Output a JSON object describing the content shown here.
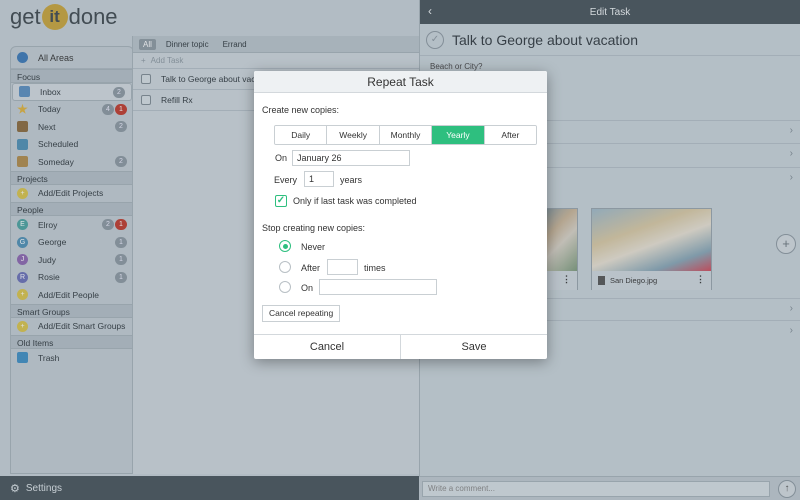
{
  "app": {
    "logo_left": "get",
    "logo_mid": "it",
    "logo_right": "done"
  },
  "sidebar": {
    "all_areas": "All Areas",
    "sections": {
      "focus": "Focus",
      "projects": "Projects",
      "people": "People",
      "smart_groups": "Smart Groups",
      "old_items": "Old Items"
    },
    "focus_items": [
      {
        "label": "Inbox",
        "badge": "2"
      },
      {
        "label": "Today",
        "badge": "4",
        "badge_red": "1"
      },
      {
        "label": "Next",
        "badge": "2"
      },
      {
        "label": "Scheduled"
      },
      {
        "label": "Someday",
        "badge": "2"
      }
    ],
    "projects_items": [
      {
        "label": "Add/Edit Projects"
      }
    ],
    "people_items": [
      {
        "label": "Elroy",
        "initial": "E",
        "badge": "2",
        "badge_red": "1",
        "color": "#4aa3a0"
      },
      {
        "label": "George",
        "initial": "G",
        "badge": "1",
        "color": "#4d8fb5"
      },
      {
        "label": "Judy",
        "initial": "J",
        "badge": "1",
        "color": "#8c66b0"
      },
      {
        "label": "Rosie",
        "initial": "R",
        "badge": "1",
        "color": "#6a6fb8"
      },
      {
        "label": "Add/Edit People"
      }
    ],
    "smart_items": [
      {
        "label": "Add/Edit Smart Groups"
      }
    ],
    "old_items": [
      {
        "label": "Trash"
      }
    ]
  },
  "settings_label": "Settings",
  "task_list": {
    "tags": [
      "All",
      "Dinner topic",
      "Errand"
    ],
    "add_placeholder": "Add Task",
    "tasks": [
      "Talk to George about vac",
      "Refill Rx"
    ]
  },
  "edit_task": {
    "header": "Edit Task",
    "title": "Talk to George about vacation",
    "note": "Beach or City?",
    "photos": [
      {
        "caption": "San Diego.jpg"
      }
    ],
    "comment_placeholder": "Write a comment..."
  },
  "repeat_dialog": {
    "title": "Repeat Task",
    "create_label": "Create new copies:",
    "options": [
      "Daily",
      "Weekly",
      "Monthly",
      "Yearly",
      "After"
    ],
    "selected_option": "Yearly",
    "on_label": "On",
    "on_value": "January 26",
    "every_label": "Every",
    "every_value": "1",
    "every_unit": "years",
    "only_if_completed": "Only if last task was completed",
    "only_if_completed_checked": true,
    "stop_label": "Stop creating new copies:",
    "stop_never": "Never",
    "stop_after": "After",
    "stop_after_unit": "times",
    "stop_on": "On",
    "stop_selected": "Never",
    "cancel_repeating": "Cancel repeating",
    "cancel": "Cancel",
    "save": "Save"
  },
  "colors": {
    "accent_green": "#2ebf7f",
    "header_dark": "#46525a",
    "badge_red": "#c0392b"
  }
}
